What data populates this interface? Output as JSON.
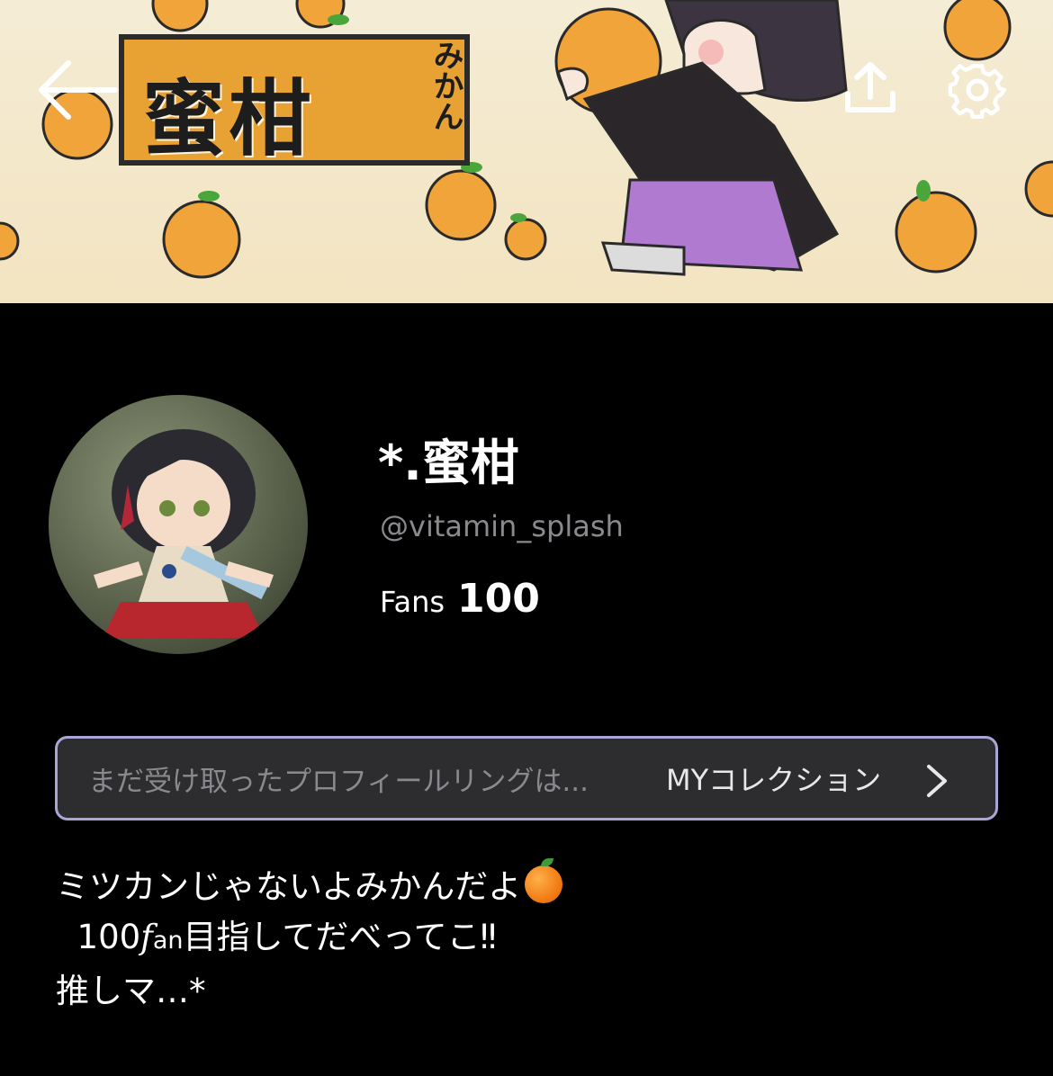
{
  "header": {
    "banner_title": "蜜柑",
    "banner_ruby": "みかん",
    "back_icon": "back-arrow-icon",
    "share_icon": "share-icon",
    "settings_icon": "gear-icon"
  },
  "profile": {
    "name_prefix": "",
    "name_suffix": "*.蜜柑",
    "handle": "@vitamin_splash",
    "fans_label": "Fans",
    "fans_count": "100"
  },
  "collection": {
    "hint": "まだ受け取ったプロフィールリングは...",
    "link_label": "MYコレクション",
    "border_color": "#a9a6d6"
  },
  "bio": {
    "line1": "ミツカンじゃないよみかんだよ",
    "line2_prefix": "  100",
    "line2_fan_f": "f",
    "line2_fan_an": "an",
    "line2_suffix": "目指してだべってこ‼",
    "line3": "",
    "line4_prefix": "推しマ…",
    "line4_suffix": "*"
  },
  "colors": {
    "background": "#000000",
    "accent_border": "#a9a6d6",
    "muted_text": "#8a8a8e"
  }
}
